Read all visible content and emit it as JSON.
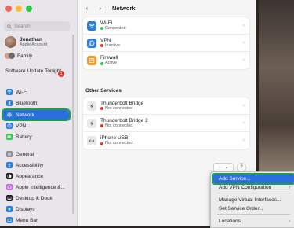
{
  "window": {
    "title": "Network"
  },
  "search": {
    "placeholder": "Search"
  },
  "account": {
    "name": "Jonathan",
    "subtitle": "Apple Account"
  },
  "family": {
    "label": "Family"
  },
  "software_update": {
    "label": "Software Update Tonight",
    "badge": "1"
  },
  "sidebar": {
    "items": [
      {
        "label": "Wi-Fi",
        "icon": "wifi-icon",
        "color": "#2a7de1"
      },
      {
        "label": "Bluetooth",
        "icon": "bluetooth-icon",
        "color": "#2a7de1"
      },
      {
        "label": "Network",
        "icon": "globe-icon",
        "color": "#2a7de1",
        "active": true
      },
      {
        "label": "VPN",
        "icon": "vpn-icon",
        "color": "#2a7de1"
      },
      {
        "label": "Battery",
        "icon": "battery-icon",
        "color": "#34c759"
      },
      {
        "label": "General",
        "icon": "gear-icon",
        "color": "#8e8e93"
      },
      {
        "label": "Accessibility",
        "icon": "accessibility-icon",
        "color": "#2a7de1"
      },
      {
        "label": "Appearance",
        "icon": "appearance-icon",
        "color": "#1c1c1e"
      },
      {
        "label": "Apple Intelligence &...",
        "icon": "apple-intelligence-icon",
        "color": "#c66be0"
      },
      {
        "label": "Desktop & Dock",
        "icon": "dock-icon",
        "color": "#1c1c1e"
      },
      {
        "label": "Displays",
        "icon": "display-icon",
        "color": "#2a7de1"
      },
      {
        "label": "Menu Bar",
        "icon": "menubar-icon",
        "color": "#2a7de1"
      }
    ]
  },
  "main": {
    "services": [
      {
        "title": "Wi-Fi",
        "status": "Connected",
        "status_color": "#34c759",
        "icon": "wifi-icon",
        "icon_bg": "#2a7de1"
      },
      {
        "title": "VPN",
        "status": "Inactive",
        "status_color": "#e5332a",
        "icon": "vpn-icon",
        "icon_bg": "#2a7de1"
      },
      {
        "title": "Firewall",
        "status": "Active",
        "status_color": "#34c759",
        "icon": "firewall-icon",
        "icon_bg": "#f39a2b"
      }
    ],
    "other_services_title": "Other Services",
    "other_services": [
      {
        "title": "Thunderbolt Bridge",
        "status": "Not connected",
        "status_color": "#e5332a",
        "icon": "thunderbolt-icon"
      },
      {
        "title": "Thunderbolt Bridge 2",
        "status": "Not connected",
        "status_color": "#e5332a",
        "icon": "thunderbolt-icon"
      },
      {
        "title": "iPhone USB",
        "status": "Not connected",
        "status_color": "#e5332a",
        "icon": "iphone-usb-icon"
      }
    ],
    "more_button": "···",
    "help_button": "?"
  },
  "menu": {
    "items": [
      {
        "label": "Add Service...",
        "highlighted": true
      },
      {
        "label": "Add VPN Configuration",
        "submenu": true
      },
      {
        "label": "Manage Virtual Interfaces..."
      },
      {
        "label": "Set Service Order..."
      },
      {
        "label": "Locations",
        "submenu": true
      }
    ]
  }
}
